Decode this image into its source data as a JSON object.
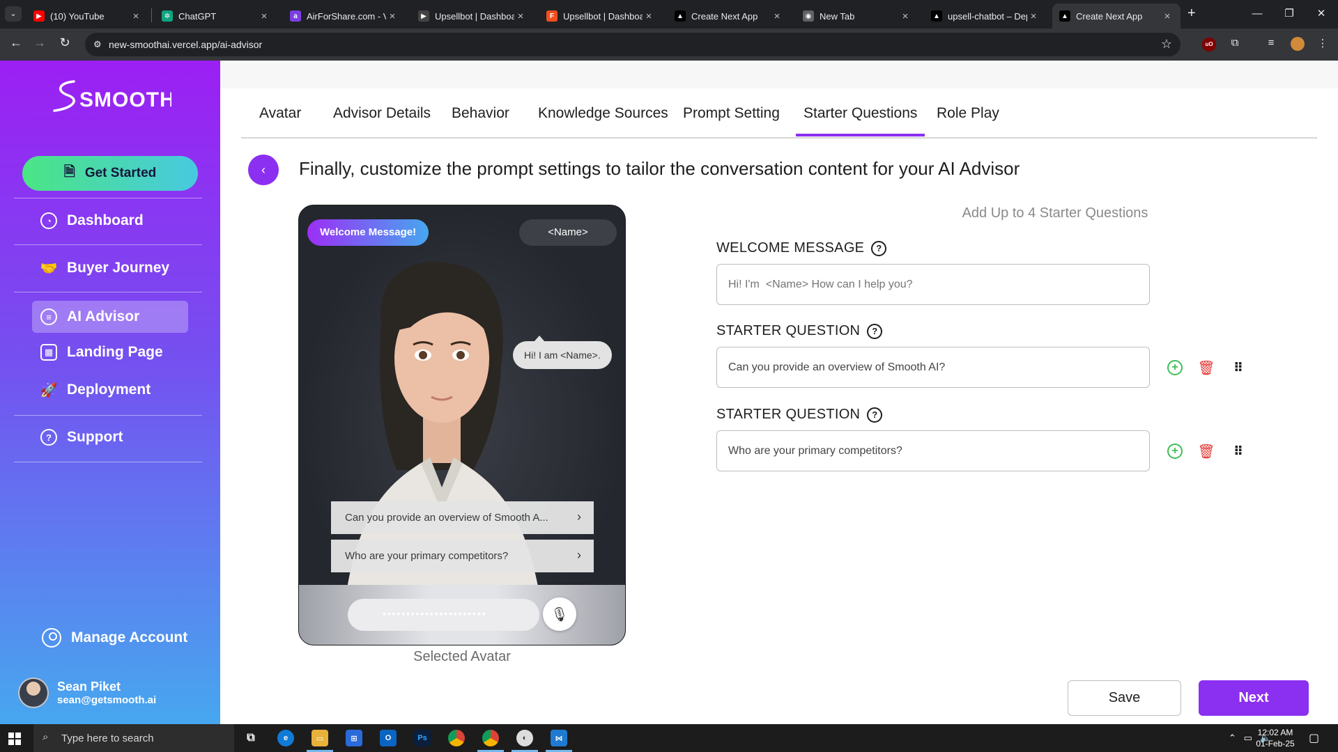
{
  "browser": {
    "tabs": [
      {
        "label": "(10) YouTube",
        "icon": "youtube-icon",
        "color": "#ff0000"
      },
      {
        "label": "ChatGPT",
        "icon": "chatgpt-icon",
        "color": "#10a37f"
      },
      {
        "label": "AirForShare.com - Vir",
        "icon": "airforshare-icon",
        "color": "#7b3fe4"
      },
      {
        "label": "Upsellbot | Dashboar",
        "icon": "play-icon",
        "color": "#444444"
      },
      {
        "label": "Upsellbot | Dashboar",
        "icon": "figma-icon",
        "color": "#f24e1e"
      },
      {
        "label": "Create Next App",
        "icon": "vercel-icon",
        "color": "#000000"
      },
      {
        "label": "New Tab",
        "icon": "chrome-icon",
        "color": "#5f6368"
      },
      {
        "label": "upsell-chatbot – Dep",
        "icon": "vercel-icon",
        "color": "#000000"
      },
      {
        "label": "Create Next App",
        "icon": "vercel-icon",
        "color": "#000000",
        "active": true
      }
    ],
    "url": "new-smoothai.vercel.app/ai-advisor"
  },
  "sidebar": {
    "logo": "SMOOTH",
    "get_started": "Get Started",
    "items": [
      {
        "label": "Dashboard",
        "icon": "pie-chart-icon"
      },
      {
        "label": "Buyer Journey",
        "icon": "handshake-icon"
      },
      {
        "label": "AI Advisor",
        "icon": "chat-icon",
        "active": true
      },
      {
        "label": "Landing Page",
        "icon": "layout-icon"
      },
      {
        "label": "Deployment",
        "icon": "rocket-icon"
      },
      {
        "label": "Support",
        "icon": "help-icon"
      }
    ],
    "manage_account": "Manage Account",
    "user": {
      "name": "Sean Piket",
      "email": "sean@getsmooth.ai"
    }
  },
  "main": {
    "tabs": [
      "Avatar",
      "Advisor Details",
      "Behavior",
      "Knowledge Sources",
      "Prompt Setting",
      "Starter Questions",
      "Role Play"
    ],
    "active_tab": "Starter Questions",
    "headline": "Finally, customize the prompt settings to tailor the conversation content for your AI Advisor",
    "preview": {
      "welcome_pill": "Welcome Message!",
      "name_pill": "<Name>",
      "speech": "Hi! I am <Name>.",
      "questions": [
        "Can you provide an overview of Smooth A...",
        "Who are your primary competitors?"
      ],
      "caption": "Selected Avatar"
    },
    "form": {
      "hint": "Add Up to 4 Starter Questions",
      "welcome_label": "WELCOME MESSAGE",
      "welcome_placeholder": "Hi! I'm  <Name> How can I help you?",
      "starter_label": "STARTER QUESTION",
      "starter_1": "Can you provide an overview of Smooth AI?",
      "starter_2": "Who are your primary competitors?"
    },
    "save_label": "Save",
    "next_label": "Next"
  },
  "taskbar": {
    "search_placeholder": "Type here to search",
    "time": "12:02 AM",
    "date": "01-Feb-25"
  },
  "colors": {
    "accent": "#8b2ff0",
    "add": "#3dbf55",
    "delete": "#e53935"
  }
}
